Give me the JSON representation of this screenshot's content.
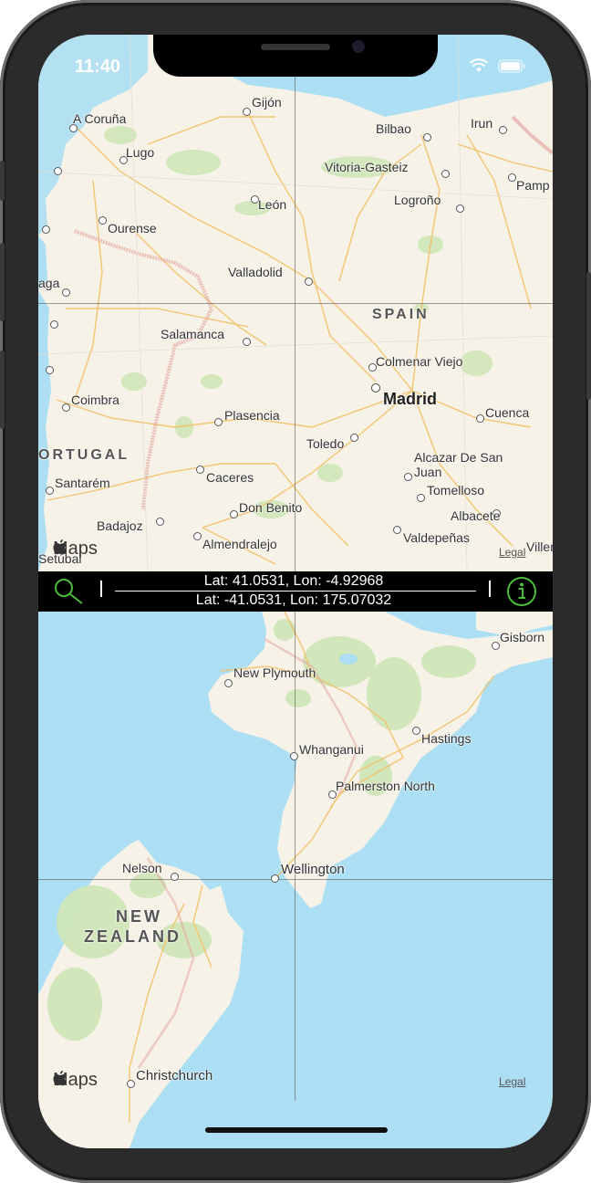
{
  "status": {
    "time": "11:40"
  },
  "top_map": {
    "country_label": "SPAIN",
    "country_label_2": "ORTUGAL",
    "cities": [
      {
        "name": "A Coruña"
      },
      {
        "name": "Gijón"
      },
      {
        "name": "Bilbao"
      },
      {
        "name": "Irun"
      },
      {
        "name": "Lugo"
      },
      {
        "name": "Vitoria-Gasteiz"
      },
      {
        "name": "Pamp"
      },
      {
        "name": "León"
      },
      {
        "name": "Logroño"
      },
      {
        "name": "Ourense"
      },
      {
        "name": "Valladolid"
      },
      {
        "name": "aga"
      },
      {
        "name": "Salamanca"
      },
      {
        "name": "Colmenar Viejo"
      },
      {
        "name": "Madrid"
      },
      {
        "name": "Coimbra"
      },
      {
        "name": "Plasencia"
      },
      {
        "name": "Cuenca"
      },
      {
        "name": "Toledo"
      },
      {
        "name": "Alcazar De San Juan"
      },
      {
        "name": "Santarém"
      },
      {
        "name": "Caceres"
      },
      {
        "name": "Tomelloso"
      },
      {
        "name": "Setúbal"
      },
      {
        "name": "Don Benito"
      },
      {
        "name": "Albacete"
      },
      {
        "name": "Badajoz"
      },
      {
        "name": "Almendralejo"
      },
      {
        "name": "Valdepeñas"
      },
      {
        "name": "Villen"
      }
    ],
    "maps_brand": "Maps",
    "legal": "Legal"
  },
  "control_bar": {
    "coord_top": "Lat: 41.0531, Lon: -4.92968",
    "coord_bottom": "Lat: -41.0531, Lon: 175.07032"
  },
  "bottom_map": {
    "country_label_line1": "NEW",
    "country_label_line2": "ZEALAND",
    "cities": [
      {
        "name": "Gisborn"
      },
      {
        "name": "New Plymouth"
      },
      {
        "name": "Hastings"
      },
      {
        "name": "Whanganui"
      },
      {
        "name": "Palmerston North"
      },
      {
        "name": "Nelson"
      },
      {
        "name": "Wellington"
      },
      {
        "name": "Christchurch"
      }
    ],
    "maps_brand": "Maps",
    "legal": "Legal"
  },
  "colors": {
    "land": "#f7f2e7",
    "water": "#acdff3",
    "road": "#f2c36b",
    "green": "#cfe6b8",
    "accent": "#4cbb3c"
  },
  "icons": {
    "search": "search-icon",
    "info": "info-icon"
  }
}
